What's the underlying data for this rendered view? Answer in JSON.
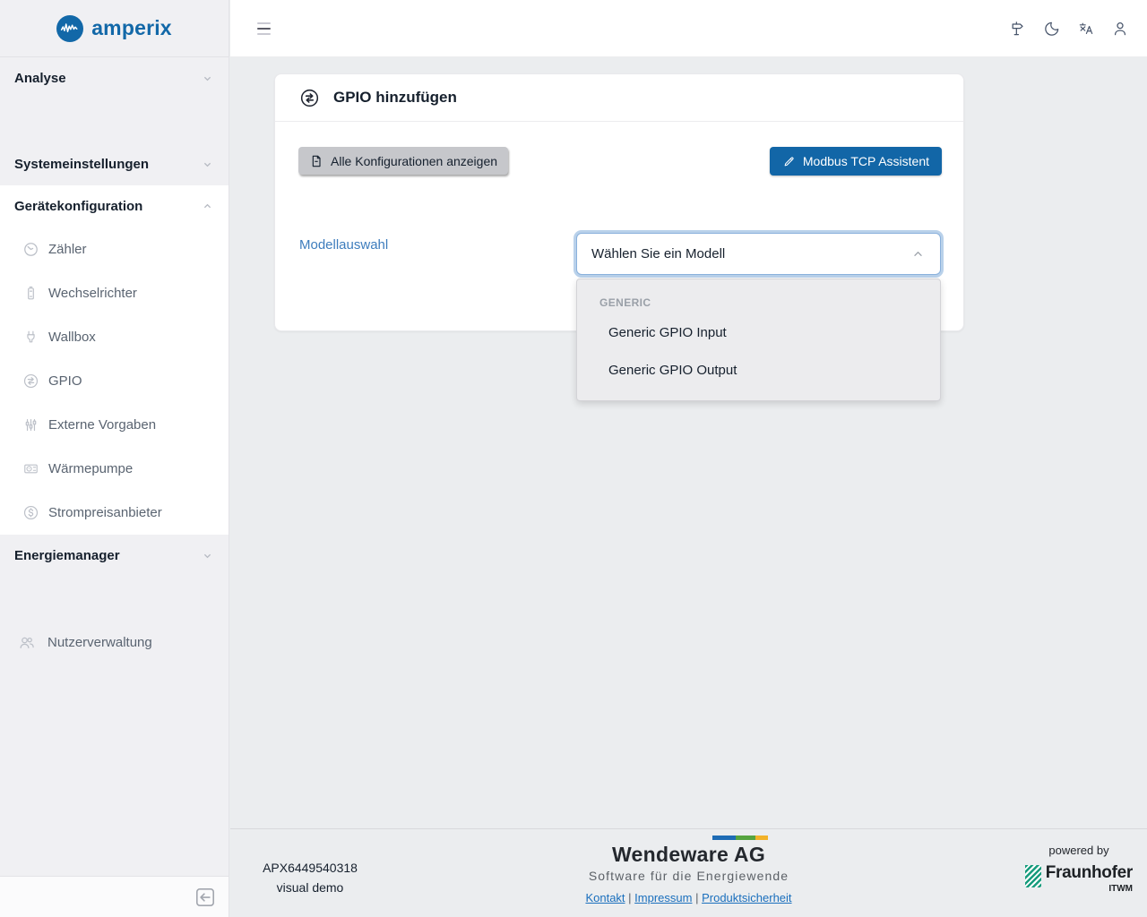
{
  "brand": {
    "name": "amperix",
    "logo_icon": "waveform-circle-icon"
  },
  "topbar": {
    "menu_icon": "hamburger-menu-icon",
    "icons": [
      "signpost-icon",
      "moon-dark-mode-icon",
      "translate-language-icon",
      "user-profile-icon"
    ]
  },
  "sidebar": {
    "sections": {
      "analyse": "Analyse",
      "systemeinstellungen": "Systemeinstellungen",
      "geraetekonfiguration": "Gerätekonfiguration",
      "energiemanager": "Energiemanager"
    },
    "device_items": [
      {
        "label": "Zähler",
        "icon": "meter-gauge-icon"
      },
      {
        "label": "Wechselrichter",
        "icon": "inverter-battery-icon"
      },
      {
        "label": "Wallbox",
        "icon": "plug-icon"
      },
      {
        "label": "GPIO",
        "icon": "gpio-swap-icon"
      },
      {
        "label": "Externe Vorgaben",
        "icon": "sliders-icon"
      },
      {
        "label": "Wärmepumpe",
        "icon": "heat-pump-icon"
      },
      {
        "label": "Strompreisanbieter",
        "icon": "price-dollar-circle-icon"
      }
    ],
    "user_management": "Nutzerverwaltung",
    "collapse_icon": "collapse-sidebar-arrow-icon"
  },
  "card": {
    "icon": "gpio-swap-icon",
    "title": "GPIO hinzufügen",
    "buttons": {
      "show_all_configs": "Alle Konfigurationen anzeigen",
      "modbus_assistant": "Modbus TCP Assistent"
    },
    "form": {
      "model_label": "Modellauswahl",
      "select_value": "Wählen Sie ein Modell",
      "dropdown": {
        "state": "open",
        "group": "GENERIC",
        "options": [
          "Generic GPIO Input",
          "Generic GPIO Output"
        ]
      }
    }
  },
  "footer": {
    "serial": "APX6449540318",
    "mode": "visual demo",
    "company": "Wendeware AG",
    "tagline": "Software für die Energiewende",
    "links": [
      "Kontakt",
      "Impressum",
      "Produktsicherheit"
    ],
    "powered_by": "powered by",
    "fraunhofer": "Fraunhofer",
    "fraunhofer_sub": "ITWM"
  },
  "colors": {
    "accent_blue": "#1268a8",
    "button_blue": "#1266a7",
    "label_blue": "#3e7dbd",
    "link_blue": "#1a6fbd",
    "focus_ring": "#b9d1ea",
    "fraunhofer_green": "#179c7d",
    "bar_blue": "#1e6cb5",
    "bar_green": "#55a43f",
    "bar_yellow": "#f2b229"
  }
}
